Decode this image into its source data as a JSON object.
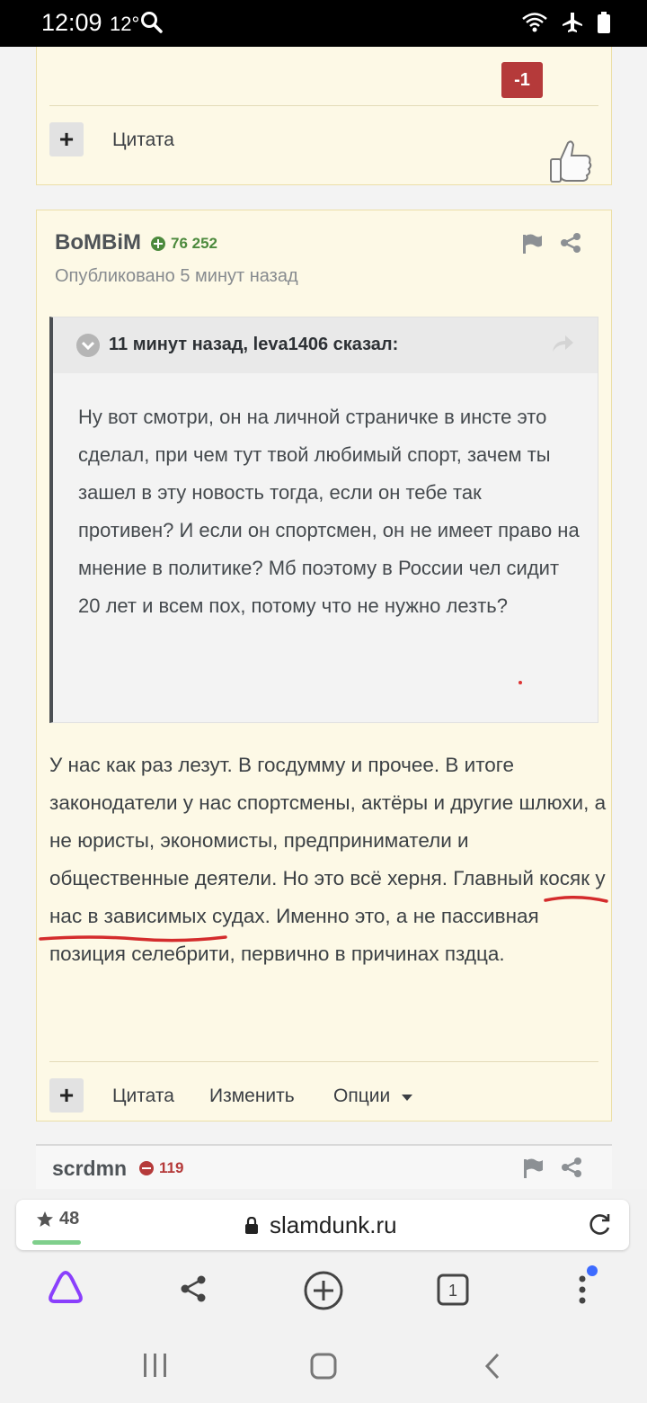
{
  "status_bar": {
    "time": "12:09",
    "temperature": "12°",
    "icons": [
      "search-icon",
      "wifi-icon",
      "airplane-icon",
      "battery-icon"
    ]
  },
  "post_prev": {
    "quote_label": "Цитата",
    "vote_value": "-1"
  },
  "post_main": {
    "author": "BoMBiM",
    "reputation": "76 252",
    "published": "Опубликовано 5 минут назад",
    "quote": {
      "title": "11 минут назад, leva1406 сказал:",
      "text": "Ну вот смотри, он на личной страничке в инсте это сделал, при чем тут твой любимый спорт, зачем ты зашел в эту новость тогда, если он тебе так противен? И если он спортсмен, он не имеет право на мнение в политике? Мб поэтому в России чел сидит 20 лет и всем пох, потому что не нужно лезть?"
    },
    "body": "У нас как раз лезут. В госдумму и прочее. В итоге законодатели у нас спортсмены, актёры и другие шлюхи, а не юристы, экономисты, предприниматели и общественные деятели. Но это всё херня. Главный косяк у нас в зависимых судах. Именно это, а не пассивная позиция селебрити, первично в причинах пздца.",
    "actions": {
      "quote": "Цитата",
      "edit": "Изменить",
      "options": "Опции"
    }
  },
  "post_next": {
    "author": "scrdmn",
    "reputation": "119"
  },
  "browser": {
    "favorites_count": "48",
    "url": "slamdunk.ru",
    "tabs_count": "1"
  },
  "colors": {
    "post_bg": "#fdf9e6",
    "post_border": "#ecdfa7",
    "negative_vote": "#b53a3a",
    "positive_rep": "#4c8a3d",
    "alice_purple": "#8a3ffc",
    "notification_dot": "#3d6bff",
    "scribble_red": "#d42c2c"
  }
}
